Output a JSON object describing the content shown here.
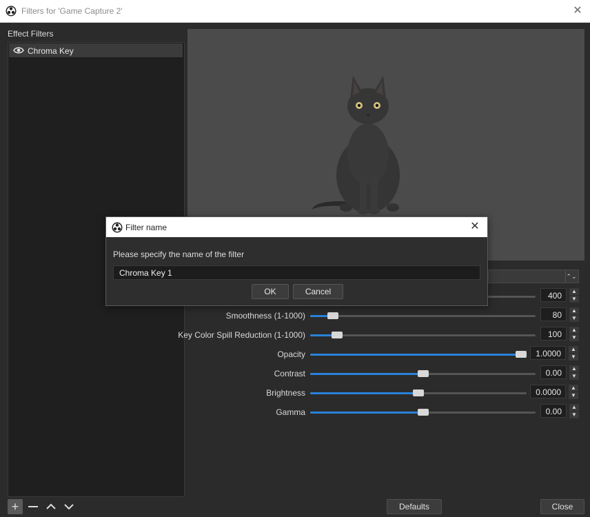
{
  "window": {
    "title": "Filters for 'Game Capture 2'"
  },
  "effect_filters": {
    "label": "Effect Filters",
    "items": [
      {
        "name": "Chroma Key",
        "visible": true
      }
    ]
  },
  "properties": [
    {
      "label": "",
      "value": "400",
      "fraction": 0.4
    },
    {
      "label": "Smoothness (1-1000)",
      "value": "80",
      "fraction": 0.08
    },
    {
      "label": "Key Color Spill Reduction (1-1000)",
      "value": "100",
      "fraction": 0.1
    },
    {
      "label": "Opacity",
      "value": "1.0000",
      "fraction": 1.0
    },
    {
      "label": "Contrast",
      "value": "0.00",
      "fraction": 0.5
    },
    {
      "label": "Brightness",
      "value": "0.0000",
      "fraction": 0.5
    },
    {
      "label": "Gamma",
      "value": "0.00",
      "fraction": 0.5
    }
  ],
  "footer": {
    "defaults_label": "Defaults",
    "close_label": "Close"
  },
  "dialog": {
    "title": "Filter name",
    "prompt": "Please specify the name of the filter",
    "input_value": "Chroma Key 1",
    "ok_label": "OK",
    "cancel_label": "Cancel"
  },
  "colors": {
    "accent": "#2a82da",
    "panel": "#2b2b2b",
    "preview": "#4b4b4b"
  }
}
